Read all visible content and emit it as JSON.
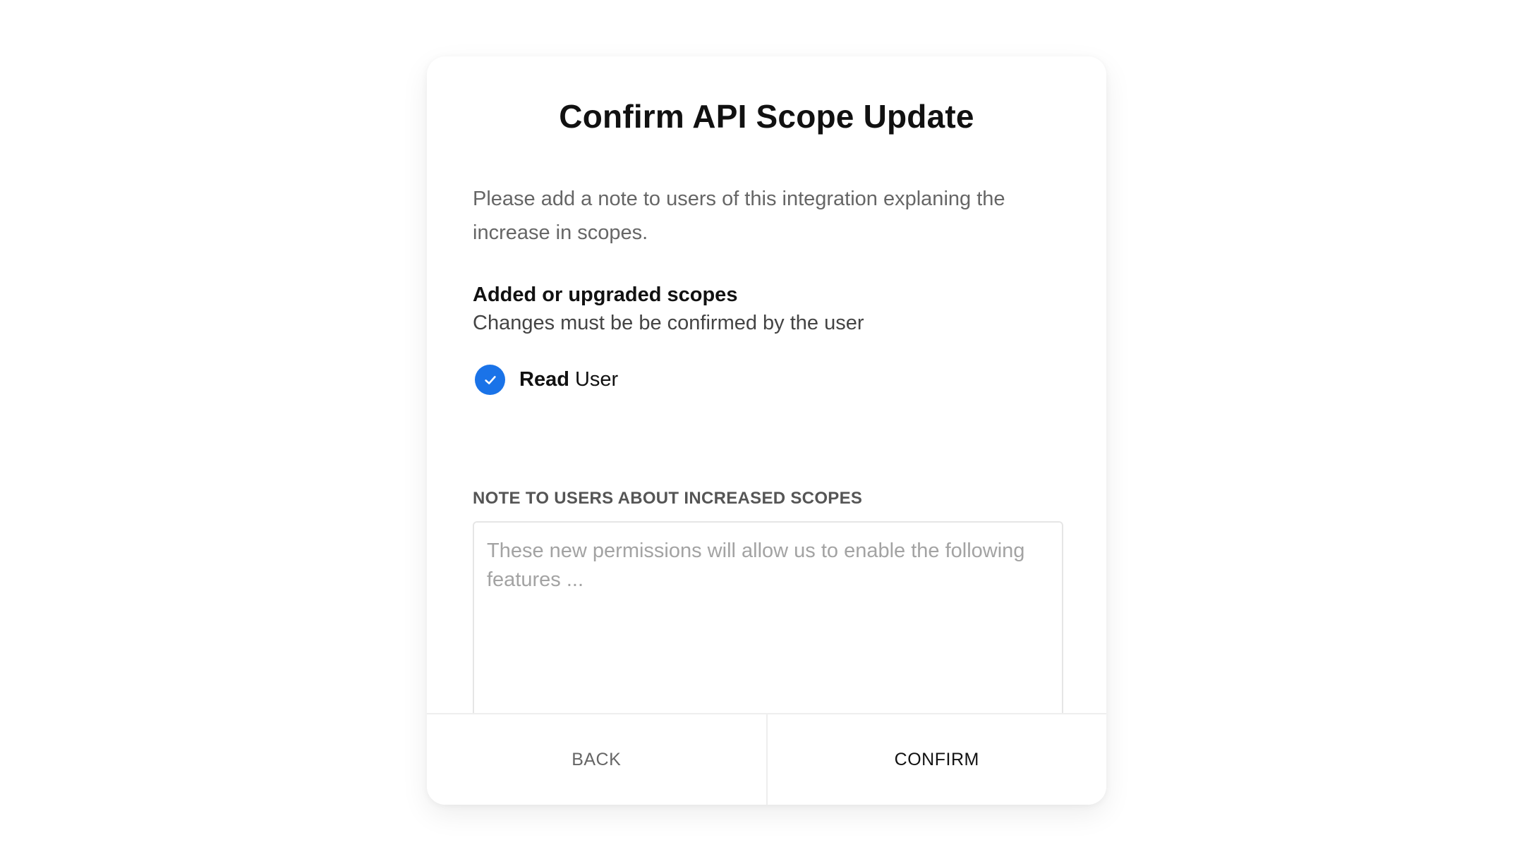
{
  "dialog": {
    "title": "Confirm API Scope Update",
    "description": "Please add a note to users of this integration explaning the increase in scopes.",
    "section": {
      "heading": "Added or upgraded scopes",
      "subtitle": "Changes must be be confirmed by the user"
    },
    "scopes": [
      {
        "action": "Read",
        "resource": "User",
        "checked": true,
        "icon": "check-icon"
      }
    ],
    "note_field": {
      "label": "NOTE TO USERS ABOUT INCREASED SCOPES",
      "placeholder": "These new permissions will allow us to enable the following features ...",
      "value": ""
    },
    "buttons": {
      "back": "BACK",
      "confirm": "CONFIRM"
    }
  },
  "colors": {
    "accent": "#1a73e8",
    "title": "#111111",
    "muted": "#666666",
    "placeholder": "#a3a3a3",
    "border": "#e6e6e6"
  }
}
